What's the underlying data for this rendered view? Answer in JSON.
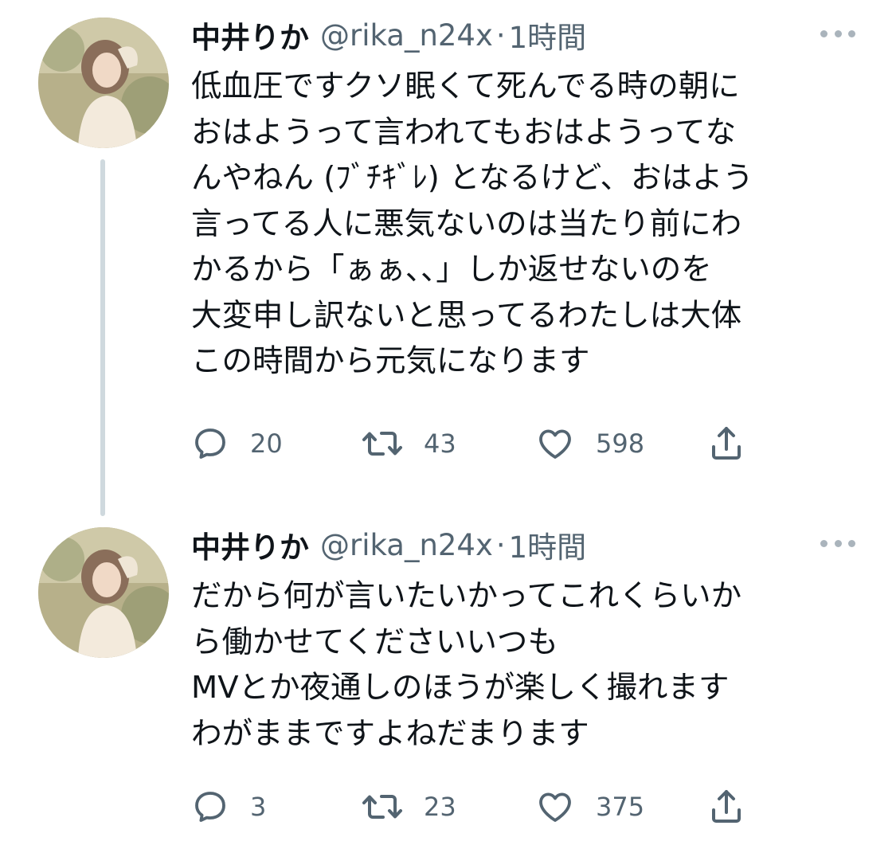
{
  "tweets": [
    {
      "display_name": "中井りか",
      "handle": "@rika_n24x",
      "separator": "·",
      "time": "1時間",
      "body_lines": [
        "低血圧ですクソ眠くて死んでる時の朝に",
        "おはようって言われてもおはようってな",
        "んやねん (ﾌﾞﾁｷﾞﾚ) となるけど、おはよう",
        "言ってる人に悪気ないのは当たり前にわ",
        "かるから「ぁぁ、、」しか返せないのを",
        "大変申し訳ないと思ってるわたしは大体",
        "この時間から元気になります"
      ],
      "reply_count": "20",
      "retweet_count": "43",
      "like_count": "598",
      "icons": {
        "avatar": "avatar-photo",
        "more": "more-horizontal-icon",
        "reply": "reply-icon",
        "retweet": "retweet-icon",
        "like": "heart-icon",
        "share": "share-icon"
      }
    },
    {
      "display_name": "中井りか",
      "handle": "@rika_n24x",
      "separator": "·",
      "time": "1時間",
      "body_lines": [
        "だから何が言いたいかってこれくらいか",
        "ら働かせてくださいいつも",
        "MVとか夜通しのほうが楽しく撮れます",
        "わがままですよねだまります"
      ],
      "reply_count": "3",
      "retweet_count": "23",
      "like_count": "375",
      "icons": {
        "avatar": "avatar-photo",
        "more": "more-horizontal-icon",
        "reply": "reply-icon",
        "retweet": "retweet-icon",
        "like": "heart-icon",
        "share": "share-icon"
      }
    }
  ],
  "colors": {
    "text_primary": "#0f1419",
    "text_secondary": "#536471",
    "thread_line": "#cfd9de",
    "icon": "#536471"
  }
}
